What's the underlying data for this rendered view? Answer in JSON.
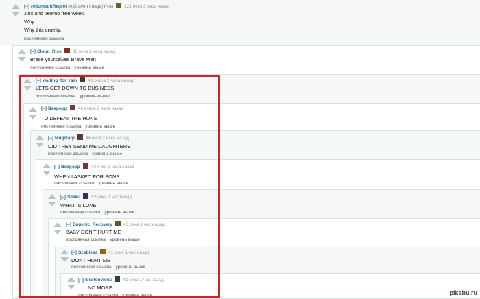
{
  "comments": [
    {
      "toggle": "[–]",
      "user": "redundantRegret",
      "flair": "[A Graven Image] (NA)",
      "points": "221 очко 3 часа назад",
      "lines": [
        "Jinx and Teemo free week.",
        "Why",
        "Why this cruelty."
      ],
      "links": [
        "постоянная ссылка"
      ],
      "avatar_color": "#6b5a2a"
    },
    {
      "toggle": "[–]",
      "user": "Cloud_Rice",
      "points": "32 очка 2 часа назад",
      "lines": [
        "Brace yourselves Brave Men"
      ],
      "links": [
        "постоянная ссылка",
        "уровень выше"
      ],
      "avatar_color": "#8a2a1a"
    },
    {
      "toggle": "[–]",
      "user": "waiting_for_rain",
      "points": "48 очков 2 часа назад",
      "lines": [
        "LETS GET DOWN TO BUSINESS"
      ],
      "links": [
        "постоянная ссылка",
        "уровень выше"
      ],
      "avatar_color": "#4a3a20"
    },
    {
      "toggle": "[–]",
      "user": "Beepopp",
      "points": "46 очков 2 часа назад",
      "lines": [
        "TO DEFEAT THE HUNS"
      ],
      "links": [
        "постоянная ссылка",
        "уровень выше"
      ],
      "avatar_color": "#7a3050"
    },
    {
      "toggle": "[–]",
      "user": "Mugikarp",
      "points": "44 очка 2 часа назад",
      "lines": [
        "DID THEY SEND ME DAUGHTERS"
      ],
      "links": [
        "постоянная ссылка",
        "уровень выше"
      ],
      "avatar_color": "#5a3a3a"
    },
    {
      "toggle": "[–]",
      "user": "Beepopp",
      "points": "42 очка 2 часа назад",
      "lines": [
        "WHEN I ASKED FOR SONS"
      ],
      "links": [
        "постоянная ссылка",
        "уровень выше"
      ],
      "avatar_color": "#7a3050"
    },
    {
      "toggle": "[–]",
      "user": "Silkku",
      "points": "52 очка 1 час назад",
      "lines": [
        "WHAT IS LOVE"
      ],
      "links": [
        "постоянная ссылка",
        "уровень выше"
      ],
      "avatar_color": "#3a2a6a"
    },
    {
      "toggle": "[–]",
      "user": "Eugenic_Recovery",
      "points": "43 очка 1 час назад",
      "lines": [
        "BABY DON'T HURT ME"
      ],
      "links": [
        "постоянная ссылка",
        "уровень выше"
      ],
      "avatar_color": "#5a5a2a"
    },
    {
      "toggle": "[–]",
      "user": "Scabiess",
      "points": "41 очко 1 час назад",
      "lines": [
        "DONT HURT ME"
      ],
      "links": [
        "постоянная ссылка",
        "уровень выше"
      ],
      "avatar_color": "#8a6a10"
    },
    {
      "toggle": "[–]",
      "user": "leestenvious",
      "points": "41 очко 1 час назад",
      "lines": [
        "NO MORE"
      ],
      "links": [
        "постоянная ссылка",
        "уровень выше"
      ],
      "avatar_color": "#2a4a2a"
    }
  ],
  "watermark": "pikabu.ru",
  "accent": {
    "red_frame": "#cc2229",
    "user_link": "#2a6b9a",
    "vote_arrow": "#b9c4c4"
  }
}
